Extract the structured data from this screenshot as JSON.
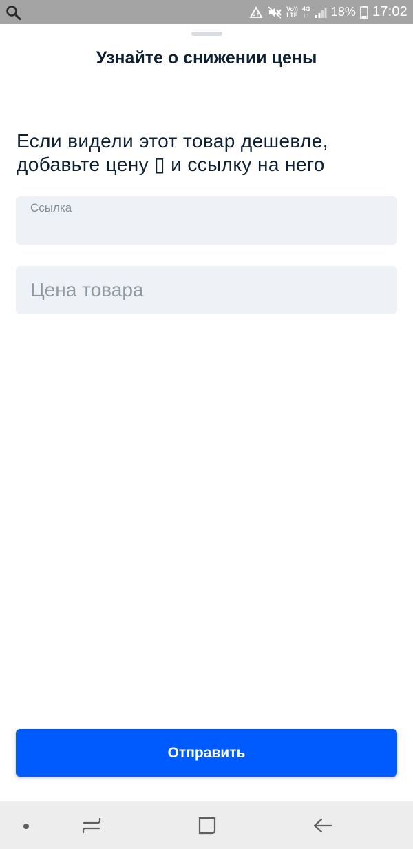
{
  "status_bar": {
    "battery": "18%",
    "time": "17:02",
    "volte_top": "Vo))",
    "volte_bottom": "LTE",
    "network": "4G",
    "icons": [
      "search-icon",
      "data-saver-icon",
      "mute-icon",
      "volte-icon",
      "network-4g-icon",
      "signal-icon",
      "battery-icon"
    ]
  },
  "sheet": {
    "title": "Узнайте о снижении цены",
    "prompt_line1": "Если видели этот товар дешевле,",
    "prompt_line2": "добавьте цену ▯ и ссылку на него"
  },
  "form": {
    "link_label": "Ссылка",
    "link_value": "",
    "price_placeholder": "Цена товара",
    "price_value": ""
  },
  "submit": {
    "label": "Отправить"
  },
  "nav_bar": {
    "icons": [
      "dot-icon",
      "recent-apps-icon",
      "home-icon",
      "back-icon"
    ]
  },
  "colors": {
    "accent": "#005bff",
    "status_bar": "#a4a4a4",
    "field_bg": "#eef2f6",
    "text": "#0f1f33"
  }
}
